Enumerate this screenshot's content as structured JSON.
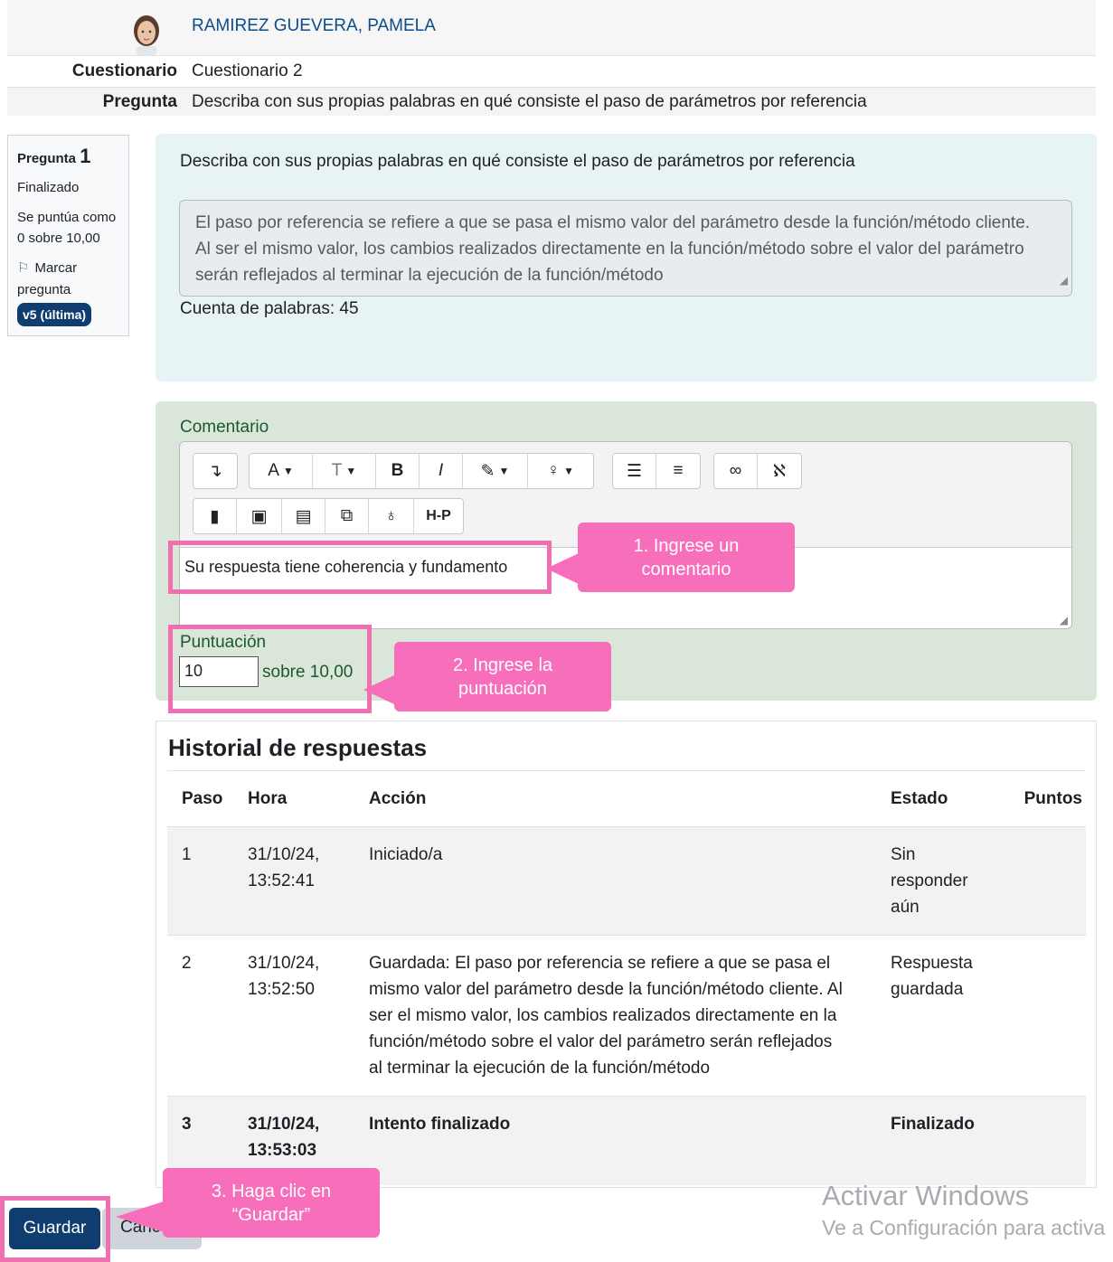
{
  "header": {
    "student_name": "RAMIREZ GUEVERA, PAMELA",
    "quiz_label": "Cuestionario",
    "quiz_value": "Cuestionario 2",
    "question_label": "Pregunta",
    "question_value": "Describa con sus propias palabras en qué consiste el paso de parámetros por referencia"
  },
  "info": {
    "question_word": "Pregunta",
    "question_number": "1",
    "state": "Finalizado",
    "score_line1": "Se puntúa como",
    "score_line2": "0 sobre 10,00",
    "flag_label1": "Marcar",
    "flag_label2": "pregunta",
    "version_badge": "v5 (última)"
  },
  "question": {
    "text": "Describa con sus propias palabras en qué consiste el paso de parámetros por referencia",
    "answer_line1": "El paso por referencia se refiere a que se pasa el mismo valor del parámetro desde la función/método cliente.",
    "answer_line2": "Al ser el mismo valor, los cambios realizados directamente en la función/método sobre el valor del parámetro",
    "answer_line3": "serán reflejados al terminar la ejecución de la función/método",
    "word_count": "Cuenta de palabras: 45"
  },
  "comment": {
    "label": "Comentario",
    "editor_text": "Su respuesta tiene coherencia y fundamento",
    "toolbar_icons": [
      "indent-icon",
      "font-color-icon",
      "font-size-icon",
      "bold-icon",
      "italic-icon",
      "highlight-icon",
      "lightbulb-icon",
      "bullet-list-icon",
      "numbered-list-icon",
      "link-icon",
      "unlink-icon",
      "paste-icon",
      "image-icon",
      "file-icon",
      "copy-icon",
      "microphone-icon",
      "h5p-icon"
    ],
    "toolbar_labels": {
      "bold": "B",
      "italic": "I",
      "h5p": "H-P",
      "font_color": "A",
      "font_size": "T"
    },
    "score_label": "Puntuación",
    "score_value": "10",
    "score_of": "sobre 10,00"
  },
  "history": {
    "title": "Historial de respuestas",
    "columns": [
      "Paso",
      "Hora",
      "Acción",
      "Estado",
      "Puntos"
    ],
    "rows": [
      {
        "step": "1",
        "time1": "31/10/24,",
        "time2": "13:52:41",
        "action": "Iniciado/a",
        "state1": "Sin",
        "state2": "responder",
        "state3": "aún",
        "points": ""
      },
      {
        "step": "2",
        "time1": "31/10/24,",
        "time2": "13:52:50",
        "action1": "Guardada: El paso por referencia se refiere a que se pasa el",
        "action2": "mismo valor del parámetro desde la función/método cliente. Al",
        "action3": "ser el mismo valor, los cambios realizados directamente en la",
        "action4": "función/método sobre el valor del parámetro serán reflejados",
        "action5": "al terminar la ejecución de la función/método",
        "state1": "Respuesta",
        "state2": "guardada",
        "points": ""
      },
      {
        "step": "3",
        "time1": "31/10/24,",
        "time2": "13:53:03",
        "action": "Intento finalizado",
        "state": "Finalizado",
        "points": ""
      }
    ]
  },
  "buttons": {
    "save": "Guardar",
    "cancel": "Cance"
  },
  "watermark": {
    "line1": "Activar Windows",
    "line2": "Ve a Configuración para activa"
  },
  "callouts": {
    "step1_line1": "1. Ingrese un",
    "step1_line2": "comentario",
    "step2_line1": "2. Ingrese la",
    "step2_line2": "puntuación",
    "step3_line1": "3. Haga clic en",
    "step3_line2": "“Guardar”"
  },
  "colors": {
    "primary": "#0f3d6f",
    "callout": "#f76fba",
    "highlight": "#f06fb1",
    "comment_bg": "#dbe6da",
    "question_bg": "#e7f3f5"
  }
}
